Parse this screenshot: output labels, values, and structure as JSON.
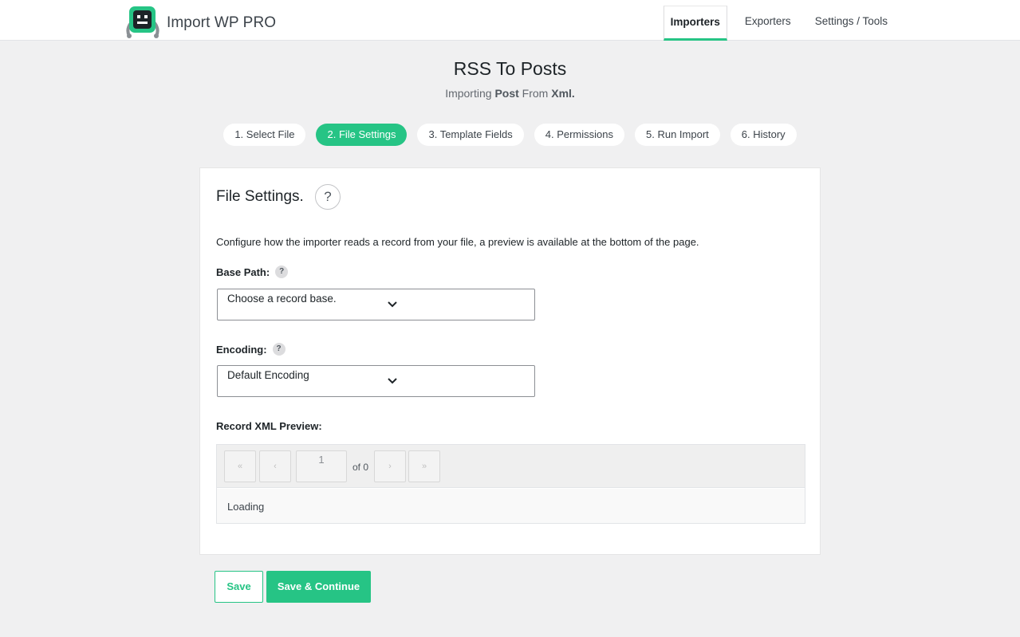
{
  "header": {
    "brand_name": "Import WP PRO",
    "logo_icon": "robot-logo-icon",
    "nav": [
      {
        "label": "Importers",
        "active": true
      },
      {
        "label": "Exporters",
        "active": false
      },
      {
        "label": "Settings / Tools",
        "active": false
      }
    ]
  },
  "page": {
    "title": "RSS To Posts",
    "subtitle_prefix": "Importing",
    "subtitle_type": "Post",
    "subtitle_mid": "From",
    "subtitle_format": "Xml."
  },
  "steps": [
    {
      "label": "1. Select File",
      "active": false
    },
    {
      "label": "2. File Settings",
      "active": true
    },
    {
      "label": "3. Template Fields",
      "active": false
    },
    {
      "label": "4. Permissions",
      "active": false
    },
    {
      "label": "5. Run Import",
      "active": false
    },
    {
      "label": "6. History",
      "active": false
    }
  ],
  "card": {
    "title": "File Settings.",
    "help_symbol": "?",
    "description": "Configure how the importer reads a record from your file, a preview is available at the bottom of the page.",
    "base_path": {
      "label": "Base Path:",
      "help_symbol": "?",
      "value": "Choose a record base."
    },
    "encoding": {
      "label": "Encoding:",
      "help_symbol": "?",
      "value": "Default Encoding"
    },
    "preview": {
      "label": "Record XML Preview:",
      "first_symbol": "«",
      "prev_symbol": "‹",
      "page_value": "1",
      "of_text": "of 0",
      "next_symbol": "›",
      "last_symbol": "»",
      "status_text": "Loading"
    }
  },
  "actions": {
    "save_label": "Save",
    "save_continue_label": "Save & Continue"
  },
  "colors": {
    "accent": "#26c485",
    "background": "#f0f0f1"
  }
}
